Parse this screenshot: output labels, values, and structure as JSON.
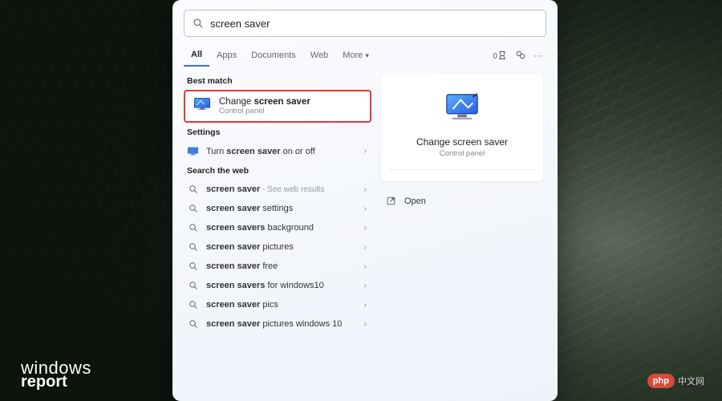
{
  "search": {
    "value": "screen saver"
  },
  "tabs": {
    "all": "All",
    "apps": "Apps",
    "documents": "Documents",
    "web": "Web",
    "more": "More"
  },
  "sections": {
    "best_match": "Best match",
    "settings": "Settings",
    "search_web": "Search the web"
  },
  "best_match": {
    "title_pre": "Change ",
    "title_bold": "screen saver",
    "subtitle": "Control panel"
  },
  "settings_items": [
    {
      "pre": "Turn ",
      "bold": "screen saver",
      "post": " on or off",
      "icon": "monitor"
    }
  ],
  "web_items": [
    {
      "bold": "screen saver",
      "post": "",
      "hint": " - See web results"
    },
    {
      "bold": "screen saver",
      "post": " settings",
      "hint": ""
    },
    {
      "bold": "screen savers",
      "post": " background",
      "hint": ""
    },
    {
      "bold": "screen saver",
      "post": " pictures",
      "hint": ""
    },
    {
      "bold": "screen saver",
      "post": " free",
      "hint": ""
    },
    {
      "bold": "screen savers",
      "post": " for windows10",
      "hint": ""
    },
    {
      "bold": "screen saver",
      "post": " pics",
      "hint": ""
    },
    {
      "bold": "screen saver",
      "post": " pictures windows 10",
      "hint": ""
    }
  ],
  "preview": {
    "title": "Change screen saver",
    "subtitle": "Control panel",
    "open": "Open"
  },
  "watermark": {
    "left1": "windows",
    "left2": "report",
    "right_badge": "php",
    "right_text": "中文网"
  }
}
